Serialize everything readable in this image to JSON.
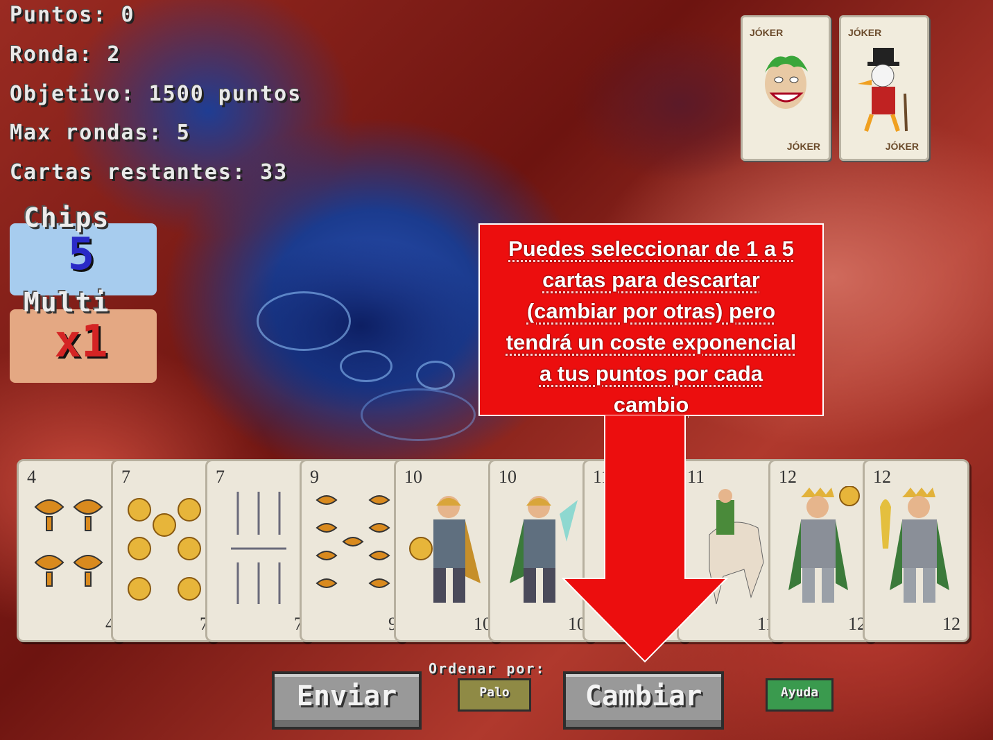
{
  "stats": {
    "points": "Puntos: 0",
    "round": "Ronda: 2",
    "objective": "Objetivo: 1500 puntos",
    "max_rounds": "Max rondas: 5",
    "cards_left": "Cartas restantes: 33"
  },
  "chips": {
    "label": "Chips",
    "value": "5"
  },
  "multi": {
    "label": "Multi",
    "value": "x1"
  },
  "jokers": [
    {
      "top": "JÓKER",
      "bottom": "JÓKER",
      "icon": "joker-face-icon"
    },
    {
      "top": "JÓKER",
      "bottom": "JÓKER",
      "icon": "duck-tycoon-icon"
    }
  ],
  "hand": [
    {
      "rank": "4",
      "suit": "copas",
      "icon": "cups-icon"
    },
    {
      "rank": "7",
      "suit": "oros",
      "icon": "coins-icon"
    },
    {
      "rank": "7",
      "suit": "espadas",
      "icon": "swords-icon"
    },
    {
      "rank": "9",
      "suit": "copas",
      "icon": "cups-icon"
    },
    {
      "rank": "10",
      "suit": "oros",
      "icon": "knight-page-icon"
    },
    {
      "rank": "10",
      "suit": "espadas",
      "icon": "knight-page-icon"
    },
    {
      "rank": "11",
      "suit": "copas",
      "icon": "knight-page-icon"
    },
    {
      "rank": "11",
      "suit": "espadas",
      "icon": "horse-rider-icon"
    },
    {
      "rank": "12",
      "suit": "oros",
      "icon": "king-icon"
    },
    {
      "rank": "12",
      "suit": "bastos",
      "icon": "king-icon"
    }
  ],
  "tooltip": {
    "line1": "Puedes seleccionar de 1 a 5",
    "line2": "cartas para descartar",
    "line3": "(cambiar por otras) pero",
    "line4": "tendrá un coste exponencial",
    "line5": "a tus puntos por cada",
    "line6": "cambio"
  },
  "controls": {
    "send": "Enviar",
    "sort_label": "Ordenar por:",
    "sort_suit": "Palo",
    "change": "Cambiar",
    "help": "Ayuda"
  },
  "colors": {
    "tooltip_bg": "#ec0e0e",
    "chips_bg": "#a7ccee",
    "multi_bg": "#e4a883",
    "palo_btn": "#8f8a45",
    "ayuda_btn": "#3a9a4e"
  }
}
